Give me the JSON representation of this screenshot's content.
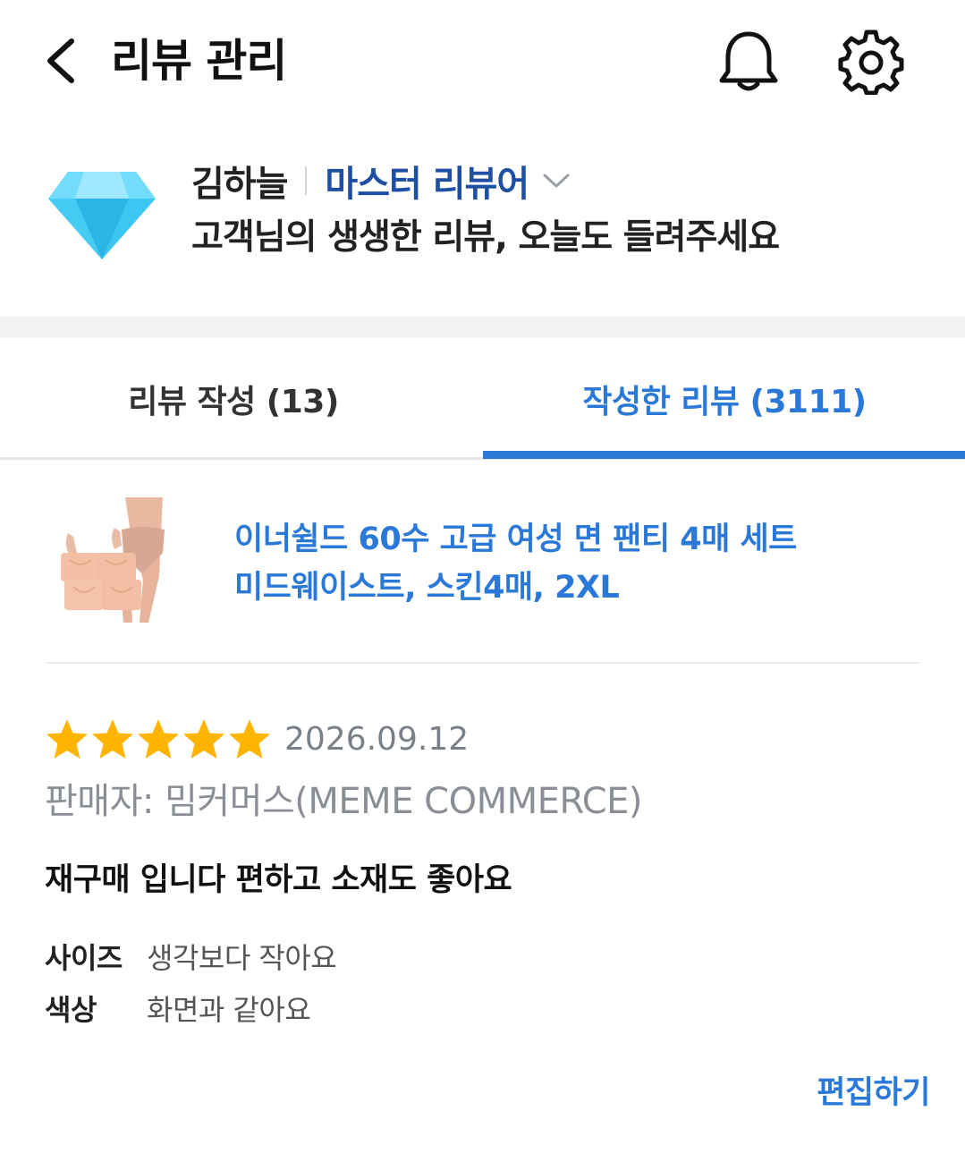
{
  "header": {
    "title": "리뷰 관리"
  },
  "profile": {
    "name": "김하늘",
    "grade": "마스터 리뷰어",
    "subtitle": "고객님의 생생한 리뷰, 오늘도 들려주세요"
  },
  "tabs": [
    {
      "label": "리뷰 작성 (13)",
      "active": false
    },
    {
      "label": "작성한 리뷰 (3111)",
      "active": true
    }
  ],
  "product": {
    "title_line1": "이너쉴드 60수 고급 여성 면 팬티 4매 세트",
    "title_line2": "미드웨이스트, 스킨4매, 2XL"
  },
  "review": {
    "rating": 5,
    "max_rating": 5,
    "date": "2026.09.12",
    "seller": "판매자: 밈커머스(MEME COMMERCE)",
    "text": "재구매 입니다 편하고 소재도 좋아요",
    "attributes": [
      {
        "label": "사이즈",
        "value": "생각보다 작아요"
      },
      {
        "label": "색상",
        "value": "화면과 같아요"
      }
    ],
    "edit_label": "편집하기"
  },
  "colors": {
    "accent": "#2a78d8",
    "grade": "#1f4fa3",
    "star": "#ffb400",
    "diamond": "#3cc6f2"
  },
  "icons": {
    "back": "chevron-left-icon",
    "bell": "bell-icon",
    "gear": "gear-icon",
    "grade_badge": "diamond-icon",
    "grade_dropdown": "chevron-down-icon",
    "star": "star-icon"
  }
}
